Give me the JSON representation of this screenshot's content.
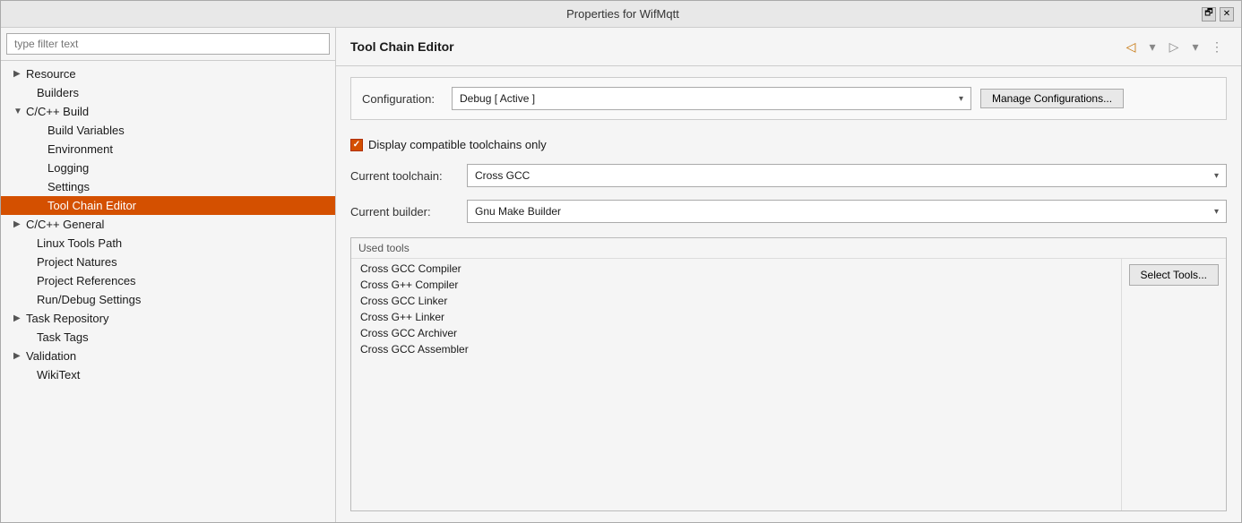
{
  "window": {
    "title": "Properties for WifMqtt"
  },
  "titlebar": {
    "restore_label": "🗗",
    "close_label": "✕"
  },
  "sidebar": {
    "filter_placeholder": "type filter text",
    "items": [
      {
        "id": "resource",
        "label": "Resource",
        "indent": 0,
        "expandable": true,
        "expanded": false
      },
      {
        "id": "builders",
        "label": "Builders",
        "indent": 1,
        "expandable": false
      },
      {
        "id": "cpp-build",
        "label": "C/C++ Build",
        "indent": 0,
        "expandable": true,
        "expanded": true
      },
      {
        "id": "build-variables",
        "label": "Build Variables",
        "indent": 2,
        "expandable": false
      },
      {
        "id": "environment",
        "label": "Environment",
        "indent": 2,
        "expandable": false
      },
      {
        "id": "logging",
        "label": "Logging",
        "indent": 2,
        "expandable": false
      },
      {
        "id": "settings",
        "label": "Settings",
        "indent": 2,
        "expandable": false
      },
      {
        "id": "tool-chain-editor",
        "label": "Tool Chain Editor",
        "indent": 2,
        "expandable": false,
        "selected": true
      },
      {
        "id": "cpp-general",
        "label": "C/C++ General",
        "indent": 0,
        "expandable": true,
        "expanded": false
      },
      {
        "id": "linux-tools-path",
        "label": "Linux Tools Path",
        "indent": 1,
        "expandable": false
      },
      {
        "id": "project-natures",
        "label": "Project Natures",
        "indent": 1,
        "expandable": false
      },
      {
        "id": "project-references",
        "label": "Project References",
        "indent": 1,
        "expandable": false
      },
      {
        "id": "run-debug-settings",
        "label": "Run/Debug Settings",
        "indent": 1,
        "expandable": false
      },
      {
        "id": "task-repository",
        "label": "Task Repository",
        "indent": 0,
        "expandable": true,
        "expanded": false
      },
      {
        "id": "task-tags",
        "label": "Task Tags",
        "indent": 1,
        "expandable": false
      },
      {
        "id": "validation",
        "label": "Validation",
        "indent": 0,
        "expandable": true,
        "expanded": false
      },
      {
        "id": "wikitext",
        "label": "WikiText",
        "indent": 1,
        "expandable": false
      }
    ]
  },
  "panel": {
    "title": "Tool Chain Editor",
    "toolbar": {
      "back_icon": "◁",
      "forward_icon": "▷",
      "menu_icon": "⋮",
      "down_icon": "▾"
    },
    "configuration_label": "Configuration:",
    "configuration_value": "Debug  [ Active ]",
    "manage_btn_label": "Manage Configurations...",
    "checkbox_label": "Display compatible toolchains only",
    "current_toolchain_label": "Current toolchain:",
    "current_toolchain_value": "Cross GCC",
    "current_builder_label": "Current builder:",
    "current_builder_value": "Gnu Make Builder",
    "used_tools_label": "Used tools",
    "used_tools": [
      "Cross GCC Compiler",
      "Cross G++ Compiler",
      "Cross GCC Linker",
      "Cross G++ Linker",
      "Cross GCC Archiver",
      "Cross GCC Assembler"
    ],
    "select_tools_btn_label": "Select Tools..."
  }
}
